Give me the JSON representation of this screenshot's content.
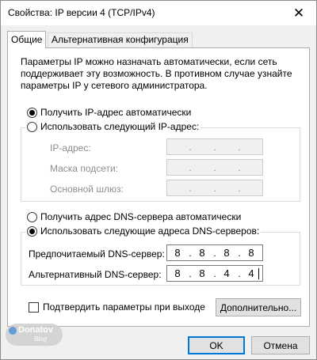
{
  "window": {
    "title": "Свойства: IP версии 4 (TCP/IPv4)",
    "close_glyph": "✕"
  },
  "tabs": [
    {
      "label": "Общие",
      "active": true
    },
    {
      "label": "Альтернативная конфигурация",
      "active": false
    }
  ],
  "description": "Параметры IP можно назначать автоматически, если сеть поддерживает эту возможность. В противном случае узнайте параметры IP у сетевого администратора.",
  "ip_section": {
    "auto_label": "Получить IP-адрес автоматически",
    "auto_selected": true,
    "manual_label": "Использовать следующий IP-адрес:",
    "manual_selected": false,
    "fields": [
      {
        "label": "IP-адрес:",
        "octets": [
          "",
          "",
          "",
          ""
        ],
        "disabled": true
      },
      {
        "label": "Маска подсети:",
        "octets": [
          "",
          "",
          "",
          ""
        ],
        "disabled": true
      },
      {
        "label": "Основной шлюз:",
        "octets": [
          "",
          "",
          "",
          ""
        ],
        "disabled": true
      }
    ]
  },
  "dns_section": {
    "auto_label": "Получить адрес DNS-сервера автоматически",
    "auto_selected": false,
    "manual_label": "Использовать следующие адреса DNS-серверов:",
    "manual_selected": true,
    "preferred": {
      "label": "Предпочитаемый DNS-сервер:",
      "octets": [
        "8",
        "8",
        "8",
        "8"
      ]
    },
    "alternate": {
      "label": "Альтернативный DNS-сервер:",
      "octets": [
        "8",
        "8",
        "4",
        "4"
      ]
    }
  },
  "validate_checkbox": {
    "label": "Подтвердить параметры при выходе",
    "checked": false
  },
  "buttons": {
    "advanced": "Дополнительно...",
    "ok": "OK",
    "cancel": "Отмена"
  },
  "watermark": {
    "name": "Donatov",
    "sub": "Blog"
  },
  "colors": {
    "accent": "#0078d7",
    "disabled_text": "#8d8d8d"
  }
}
